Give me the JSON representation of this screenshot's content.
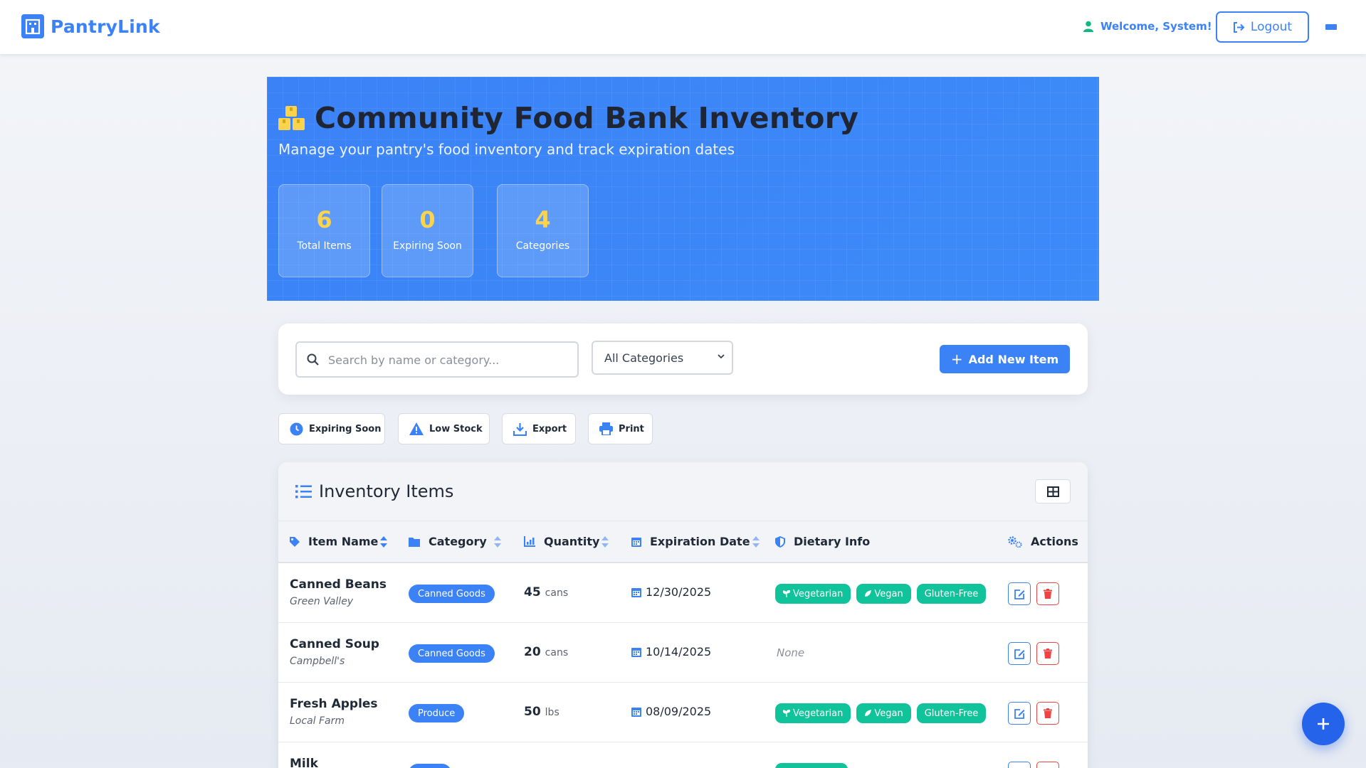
{
  "navbar": {
    "brand": "PantryLink",
    "welcome": "Welcome, System!",
    "logout": "Logout"
  },
  "hero": {
    "title": "Community Food Bank Inventory",
    "subtitle": "Manage your pantry's food inventory and track expiration dates",
    "stats": [
      {
        "value": "6",
        "label": "Total Items"
      },
      {
        "value": "0",
        "label": "Expiring Soon"
      },
      {
        "value": "4",
        "label": "Categories"
      }
    ]
  },
  "controls": {
    "search_placeholder": "Search by name or category...",
    "category_selected": "All Categories",
    "add_button": "Add New Item"
  },
  "quick_actions": [
    "Expiring Soon",
    "Low Stock",
    "Export",
    "Print"
  ],
  "inventory": {
    "title": "Inventory Items",
    "columns": [
      "Item Name",
      "Category",
      "Quantity",
      "Expiration Date",
      "Dietary Info",
      "Actions"
    ],
    "rows": [
      {
        "name": "Canned Beans",
        "brand": "Green Valley",
        "category": "Canned Goods",
        "qty": "45",
        "unit": "cans",
        "exp": "12/30/2025",
        "diet": [
          "Vegetarian",
          "Vegan",
          "Gluten-Free"
        ]
      },
      {
        "name": "Canned Soup",
        "brand": "Campbell's",
        "category": "Canned Goods",
        "qty": "20",
        "unit": "cans",
        "exp": "10/14/2025",
        "diet_none": "None"
      },
      {
        "name": "Fresh Apples",
        "brand": "Local Farm",
        "category": "Produce",
        "qty": "50",
        "unit": "lbs",
        "exp": "08/09/2025",
        "diet": [
          "Vegetarian",
          "Vegan",
          "Gluten-Free"
        ]
      },
      {
        "name": "Milk"
      }
    ]
  },
  "colors": {
    "primary": "#3b82f6",
    "accent_yellow": "#fcd34d",
    "diet_green": "#10c39a",
    "danger": "#ef4444"
  },
  "icons": {
    "brand": "building-icon",
    "hero": "boxes-icon",
    "fab": "plus-icon"
  }
}
